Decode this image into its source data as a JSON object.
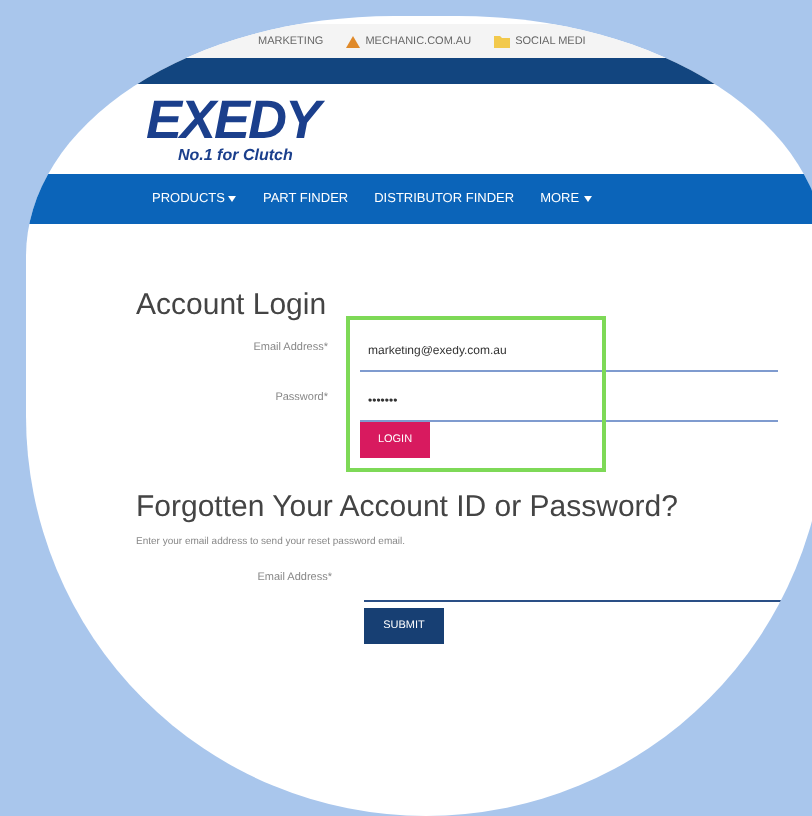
{
  "bookmarks": [
    {
      "label": "MARKETING"
    },
    {
      "label": "MECHANIC.COM.AU"
    },
    {
      "label": "SOCIAL MEDI"
    }
  ],
  "logo": {
    "wordmark": "EXEDY",
    "tagline": "No.1 for Clutch"
  },
  "nav": [
    {
      "label": "PRODUCTS",
      "dropdown": true
    },
    {
      "label": "PART FINDER",
      "dropdown": false
    },
    {
      "label": "DISTRIBUTOR FINDER",
      "dropdown": false
    },
    {
      "label": "MORE",
      "dropdown": true
    }
  ],
  "login": {
    "title": "Account Login",
    "highlighted": true,
    "fields": [
      {
        "label": "Email Address*",
        "value": "marketing@exedy.com.au"
      },
      {
        "label": "Password*",
        "value": "•••••••"
      }
    ],
    "button": "LOGIN"
  },
  "forgot": {
    "title": "Forgotten Your Account ID or Password?",
    "hint": "Enter your email address to send your reset password email.",
    "field": {
      "label": "Email Address*"
    },
    "button": "SUBMIT"
  }
}
